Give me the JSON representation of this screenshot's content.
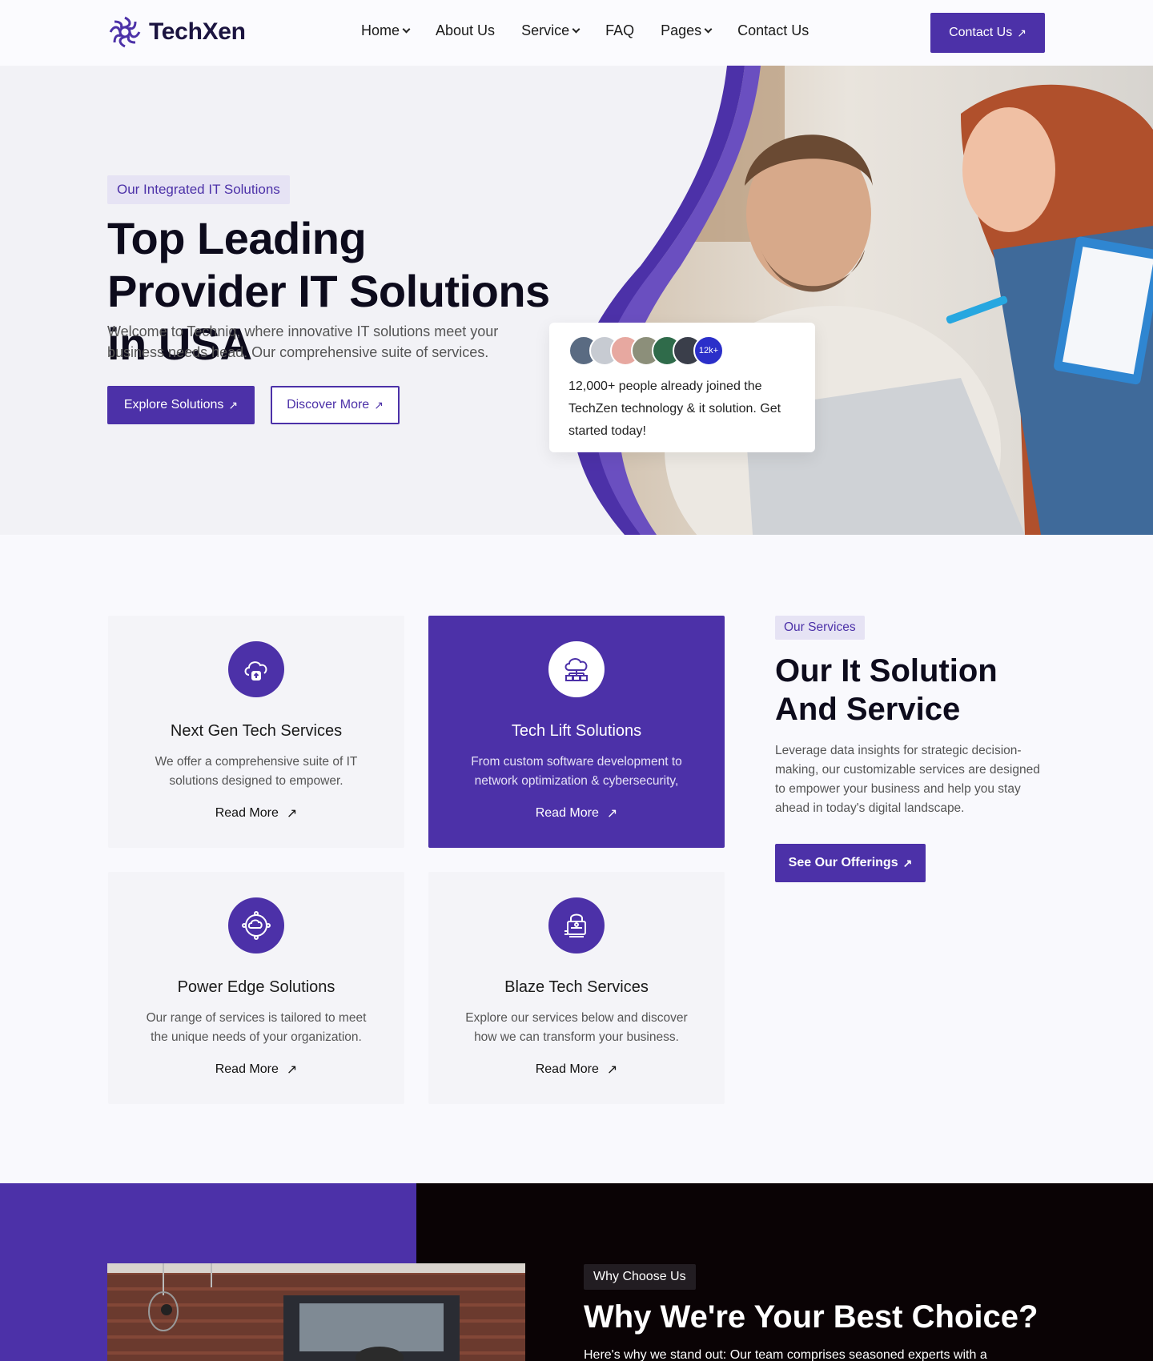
{
  "brand": {
    "name": "TechXen",
    "accent": "#4c31a8"
  },
  "nav": {
    "items": [
      {
        "label": "Home",
        "dropdown": true
      },
      {
        "label": "About Us",
        "dropdown": false
      },
      {
        "label": "Service",
        "dropdown": true
      },
      {
        "label": "FAQ",
        "dropdown": false
      },
      {
        "label": "Pages",
        "dropdown": true
      },
      {
        "label": "Contact Us",
        "dropdown": false
      }
    ],
    "cta_label": "Contact Us"
  },
  "hero": {
    "tag": "Our Integrated IT Solutions",
    "title": "Top Leading Provider IT Solutions in USA",
    "description": "Welcome to Techniq, where innovative IT solutions meet your business needs head. Our comprehensive suite of services.",
    "primary_button": "Explore Solutions",
    "secondary_button": "Discover More",
    "joined_count_badge": "12k+",
    "joined_text": "12,000+ people already joined the TechZen technology & it solution. Get started today!"
  },
  "services": {
    "tag": "Our Services",
    "heading": "Our It Solution And Service",
    "text": "Leverage data insights for strategic decision-making, our customizable services are designed to empower your business and help you stay ahead in today's digital landscape.",
    "cta": "See Our Offerings",
    "cards": [
      {
        "title": "Next Gen Tech Services",
        "description": "We offer a comprehensive suite of IT solutions designed to empower.",
        "link": "Read More",
        "icon": "cloud-upload-icon"
      },
      {
        "title": "Tech Lift Solutions",
        "description": "From custom software development to network optimization & cybersecurity,",
        "link": "Read More",
        "icon": "cloud-server-icon"
      },
      {
        "title": "Power Edge Solutions",
        "description": "Our range of services is tailored to meet the unique needs of your organization.",
        "link": "Read More",
        "icon": "cloud-network-icon"
      },
      {
        "title": "Blaze Tech Services",
        "description": "Explore our services below and discover how we can transform your business.",
        "link": "Read More",
        "icon": "secure-server-icon"
      }
    ]
  },
  "why": {
    "tag": "Why Choose Us",
    "title": "Why We're Your Best Choice?",
    "text": "Here's why we stand out: Our team comprises seasoned experts with a"
  }
}
